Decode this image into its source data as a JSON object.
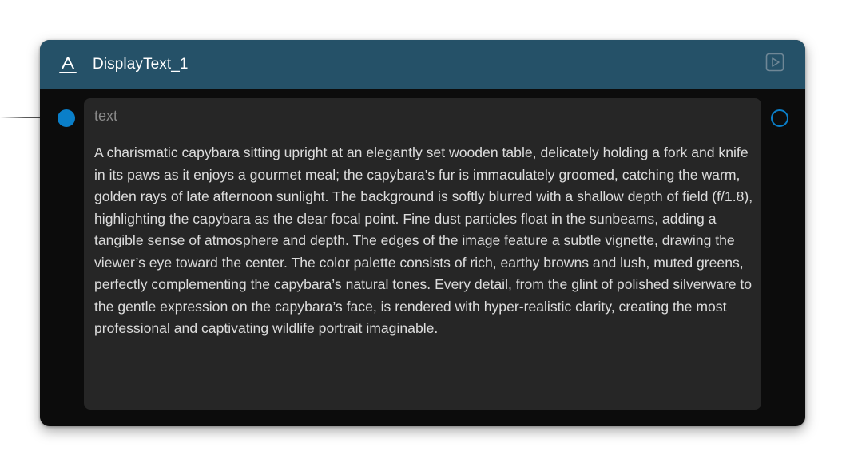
{
  "node": {
    "title": "DisplayText_1",
    "type_icon": "text-type-icon",
    "run_icon": "play-icon",
    "header_color": "#255168",
    "port_color": "#0a7fc9",
    "field": {
      "label": "text",
      "value": "A charismatic capybara sitting upright at an elegantly set wooden table, delicately holding a fork and knife in its paws as it enjoys a gourmet meal; the capybara’s fur is immaculately groomed, catching the warm, golden rays of late afternoon sunlight. The background is softly blurred with a shallow depth of field (f/1.8), highlighting the capybara as the clear focal point. Fine dust particles float in the sunbeams, adding a tangible sense of atmosphere and depth. The edges of the image feature a subtle vignette, drawing the viewer’s eye toward the center. The color palette consists of rich, earthy browns and lush, muted greens, perfectly complementing the capybara’s natural tones. Every detail, from the glint of polished silverware to the gentle expression on the capybara’s face, is rendered with hyper-realistic clarity, creating the most professional and captivating wildlife portrait imaginable."
    }
  }
}
